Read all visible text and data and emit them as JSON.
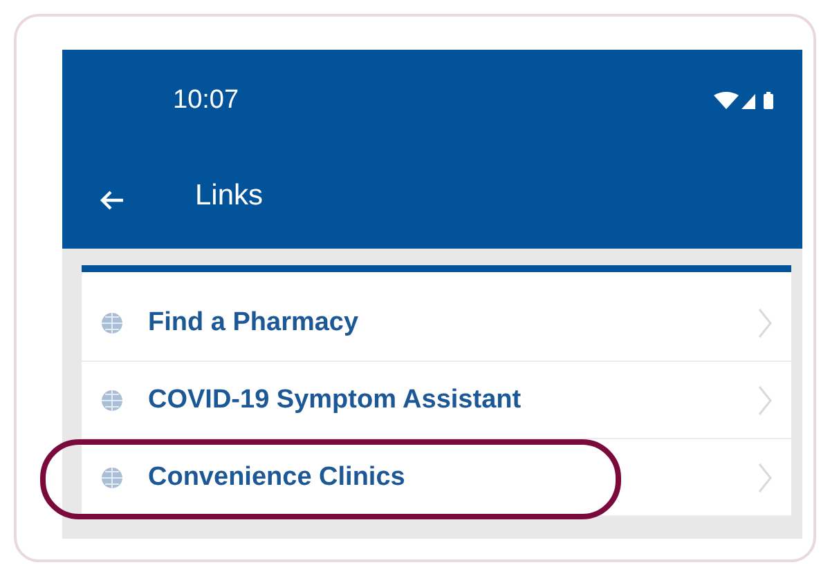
{
  "status_bar": {
    "time": "10:07"
  },
  "toolbar": {
    "title": "Links"
  },
  "links": [
    {
      "label": "Find a Pharmacy",
      "highlighted": false
    },
    {
      "label": "COVID-19 Symptom Assistant",
      "highlighted": false
    },
    {
      "label": "Convenience Clinics",
      "highlighted": true
    }
  ]
}
